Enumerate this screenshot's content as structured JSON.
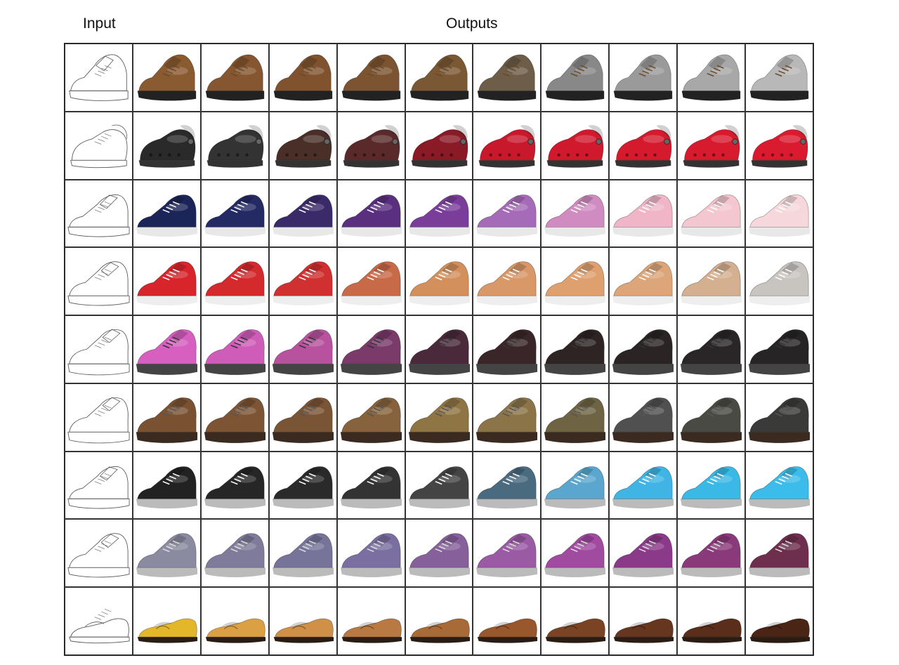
{
  "headers": {
    "input": "Input",
    "outputs": "Outputs"
  },
  "rows": [
    {
      "kind": "boot",
      "lace": "#6a4a2a",
      "sole": "#222222",
      "colors": [
        "#8a5a30",
        "#85562f",
        "#80532e",
        "#7d5431",
        "#7a5834",
        "#6e5d48",
        "#888888",
        "#9a9a9a",
        "#a8a8a8",
        "#b8b8b8"
      ]
    },
    {
      "kind": "clog",
      "lace": "#444444",
      "sole": "#333333",
      "colors": [
        "#2a2a2a",
        "#333333",
        "#4a2f28",
        "#5a2a2a",
        "#8a1a25",
        "#c8192c",
        "#d0192c",
        "#d51a2e",
        "#d81a2e",
        "#da1b2f"
      ]
    },
    {
      "kind": "sneaker",
      "lace": "#ffffff",
      "sole": "#e8e8e8",
      "colors": [
        "#1c2558",
        "#242a64",
        "#3a2a6a",
        "#5a2f80",
        "#7a3d9a",
        "#a66bb8",
        "#d08cc0",
        "#f0b6c8",
        "#f4c6d0",
        "#f6d8dc"
      ]
    },
    {
      "kind": "runner",
      "lace": "#ffffff",
      "sole": "#eeeeee",
      "colors": [
        "#d8252c",
        "#d42a2e",
        "#d0302f",
        "#c86a48",
        "#d4905c",
        "#d89868",
        "#dfa070",
        "#dda67a",
        "#d4b090",
        "#c8c4c0"
      ]
    },
    {
      "kind": "trainer",
      "lace": "#333333",
      "sole": "#444444",
      "colors": [
        "#d65fc0",
        "#cf5cb8",
        "#b8529e",
        "#7a3a6a",
        "#4a2a3a",
        "#3a2628",
        "#2e2424",
        "#2a2424",
        "#2a2628",
        "#262424"
      ]
    },
    {
      "kind": "trainer",
      "lace": "#555555",
      "sole": "#3a2a20",
      "colors": [
        "#7a5232",
        "#7d5434",
        "#7a5535",
        "#86633c",
        "#8f7444",
        "#8a7448",
        "#6e6444",
        "#505050",
        "#4a4a44",
        "#3a3a38"
      ]
    },
    {
      "kind": "sneaker",
      "lace": "#ffffff",
      "sole": "#bbbbbb",
      "colors": [
        "#222222",
        "#262626",
        "#2a2a2a",
        "#333333",
        "#444444",
        "#4a6a80",
        "#5aa6cf",
        "#40b4e4",
        "#3ab8e6",
        "#3cbcea"
      ]
    },
    {
      "kind": "runner",
      "lace": "#dddddd",
      "sole": "#bbbbbb",
      "colors": [
        "#8a8aa0",
        "#7e7c9a",
        "#77749a",
        "#7a6fa0",
        "#86609a",
        "#9a5aa4",
        "#a04aa0",
        "#8a3a88",
        "#8a3a7a",
        "#6e2e4e"
      ]
    },
    {
      "kind": "loafer",
      "lace": "#333333",
      "sole": "#2a1c12",
      "colors": [
        "#e4b62a",
        "#dca044",
        "#d09048",
        "#b87a42",
        "#a86a36",
        "#98582c",
        "#7a4424",
        "#66361e",
        "#5a2e1a",
        "#4a2414"
      ]
    }
  ]
}
